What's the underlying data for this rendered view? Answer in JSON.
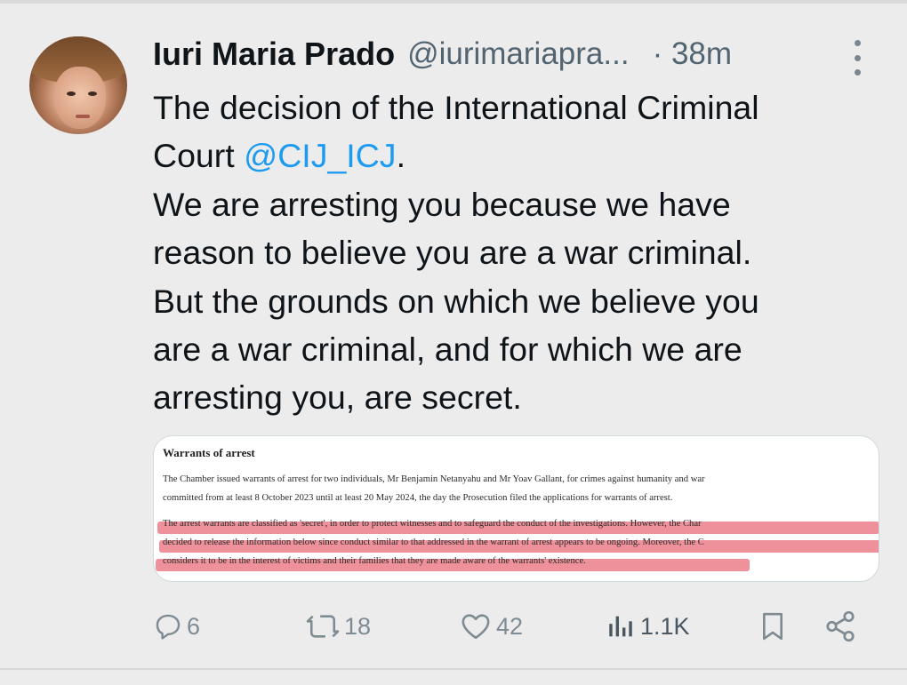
{
  "tweet": {
    "display_name": "Iuri Maria Prado",
    "handle": "@iurimariapra...",
    "time": "· 38m",
    "text_lines": [
      {
        "pre": "The decision of the International Criminal",
        "mention": "",
        "post": ""
      },
      {
        "pre": "Court ",
        "mention": "@CIJ_ICJ",
        "post": "."
      },
      {
        "pre": "We are arresting you because we have",
        "mention": "",
        "post": ""
      },
      {
        "pre": "reason to believe you are a war criminal.",
        "mention": "",
        "post": ""
      },
      {
        "pre": "But the grounds on which we believe you",
        "mention": "",
        "post": ""
      },
      {
        "pre": "are a war criminal, and for which we are",
        "mention": "",
        "post": ""
      },
      {
        "pre": "arresting you, are secret.",
        "mention": "",
        "post": ""
      }
    ]
  },
  "document": {
    "title": "Warrants of arrest",
    "paragraph1": [
      "The Chamber issued warrants of arrest for two individuals, Mr Benjamin Netanyahu and Mr Yoav Gallant, for crimes against humanity and war",
      "committed from at least 8 October 2023 until at least 20 May 2024, the day the Prosecution filed the applications for warrants of arrest."
    ],
    "paragraph2": [
      "The arrest warrants are classified as 'secret', in order to protect witnesses and to safeguard the conduct of the investigations. However, the Char",
      "decided to release the information below since conduct similar to that addressed in the warrant of arrest appears to be ongoing. Moreover, the C",
      "considers it to be in the interest of victims and their families that they are made aware of the warrants' existence."
    ]
  },
  "actions": {
    "replies": "6",
    "reposts": "18",
    "likes": "42",
    "views": "1.1K"
  },
  "icons": {
    "reply": "reply-icon",
    "repost": "repost-icon",
    "like": "like-icon",
    "views": "views-icon",
    "bookmark": "bookmark-icon",
    "share": "share-icon",
    "more": "more-icon"
  },
  "colors": {
    "mention": "#1d9bf0",
    "muted": "#536471",
    "highlight": "#e9727f"
  }
}
